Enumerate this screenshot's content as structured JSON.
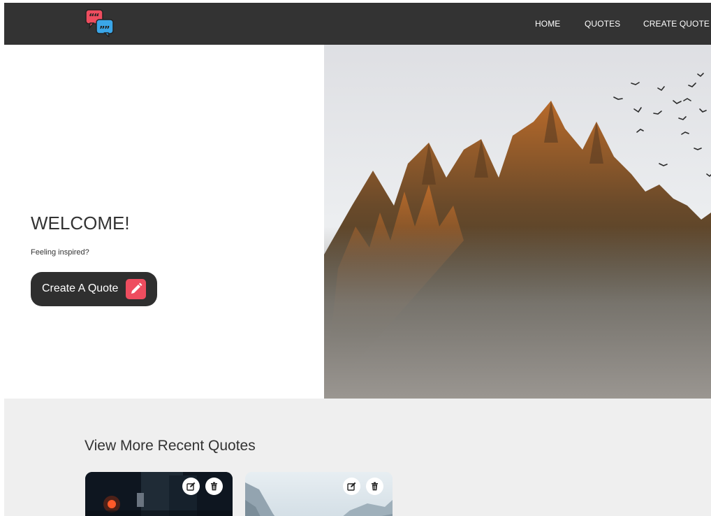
{
  "nav": {
    "links": [
      {
        "label": "HOME"
      },
      {
        "label": "QUOTES"
      },
      {
        "label": "CREATE QUOTE"
      }
    ]
  },
  "hero": {
    "title": "WELCOME!",
    "subtitle": "Feeling inspired?",
    "cta_label": "Create A Quote"
  },
  "recent": {
    "title": "View More Recent Quotes"
  },
  "colors": {
    "navbar": "#333333",
    "accent_red": "#ee4d5f",
    "accent_blue": "#3aa6e8",
    "section_bg": "#efefef"
  },
  "icons": [
    "quote-bubbles-logo-icon",
    "pencil-icon",
    "edit-icon",
    "trash-icon"
  ]
}
